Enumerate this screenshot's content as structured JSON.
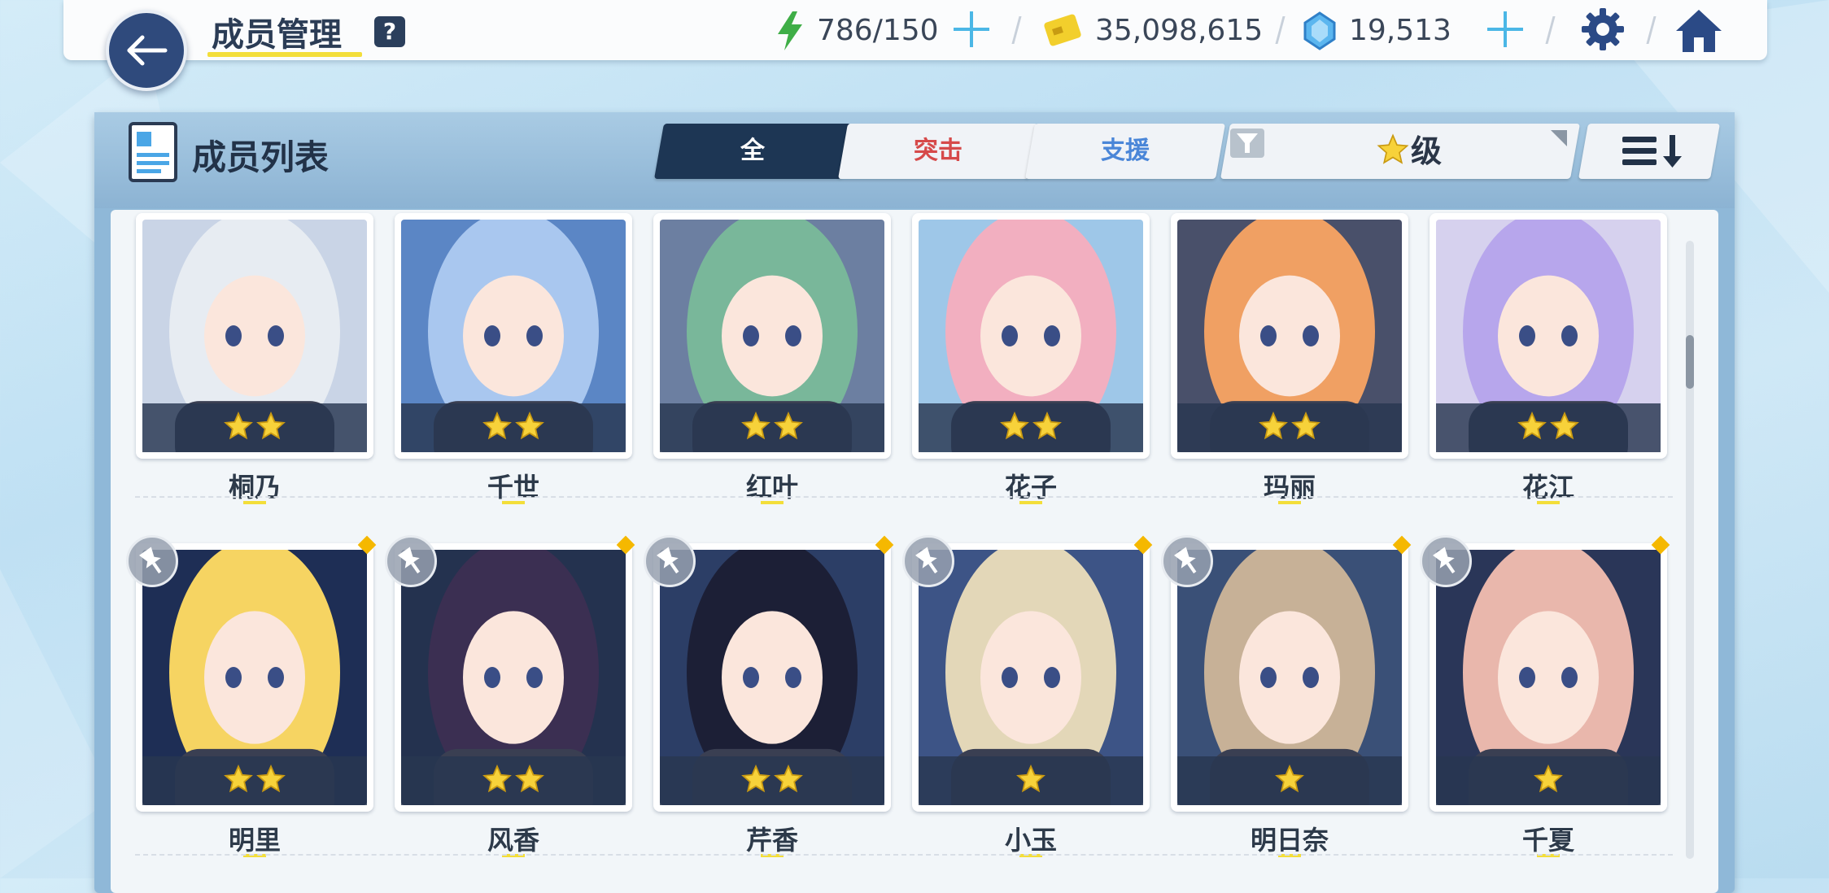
{
  "header": {
    "title": "成员管理",
    "help_label": "?",
    "stamina": "786/150",
    "credits": "35,098,615",
    "gems": "19,513"
  },
  "panel": {
    "title": "成员列表",
    "tabs": [
      {
        "label": "全",
        "color": "#ffffff"
      },
      {
        "label": "突击",
        "color": "#d64a4a"
      },
      {
        "label": "支援",
        "color": "#4a86d8"
      }
    ],
    "filter_label": "级"
  },
  "members_row1": [
    {
      "name": "桐乃",
      "stars": 2,
      "bg": "#c9d4e6",
      "hair": "#e7ecf2"
    },
    {
      "name": "千世",
      "stars": 2,
      "bg": "#5b86c5",
      "hair": "#a9c7ef"
    },
    {
      "name": "红叶",
      "stars": 2,
      "bg": "#6c7fa1",
      "hair": "#79b79a"
    },
    {
      "name": "花子",
      "stars": 2,
      "bg": "#9ec7e8",
      "hair": "#f2afc0"
    },
    {
      "name": "玛丽",
      "stars": 2,
      "bg": "#49506a",
      "hair": "#f0a063"
    },
    {
      "name": "花江",
      "stars": 2,
      "bg": "#d6d1ee",
      "hair": "#b7a6ec"
    }
  ],
  "members_row2": [
    {
      "name": "明里",
      "stars": 2,
      "bg": "#1e2e55",
      "hair": "#f6d462"
    },
    {
      "name": "风香",
      "stars": 2,
      "bg": "#24324f",
      "hair": "#3b2f52"
    },
    {
      "name": "芹香",
      "stars": 2,
      "bg": "#2c3e66",
      "hair": "#1c1f36"
    },
    {
      "name": "小玉",
      "stars": 1,
      "bg": "#3d5486",
      "hair": "#e3d7b8"
    },
    {
      "name": "明日奈",
      "stars": 1,
      "bg": "#3a5077",
      "hair": "#c7b197"
    },
    {
      "name": "千夏",
      "stars": 1,
      "bg": "#2a3658",
      "hair": "#e9b7ac"
    }
  ]
}
